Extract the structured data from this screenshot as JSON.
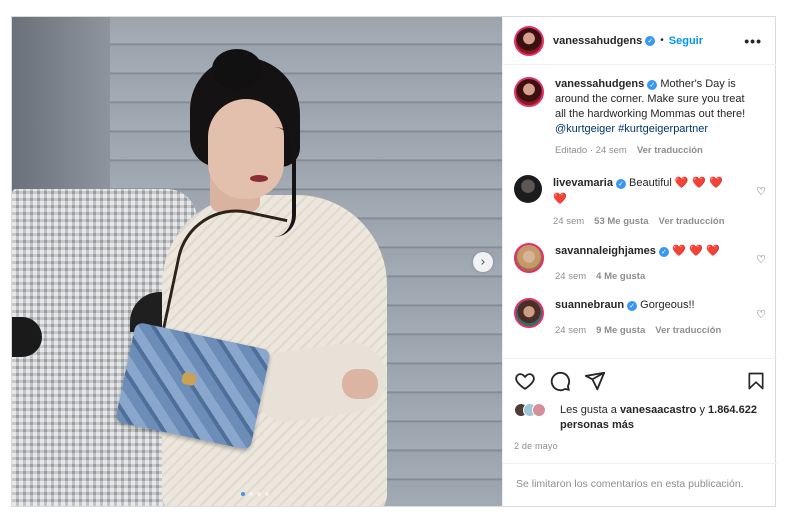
{
  "post": {
    "author": "vanessahudgens",
    "follow_label": "Seguir",
    "separator": "•",
    "more_label": "•••",
    "caption": {
      "username": "vanessahudgens",
      "text": "Mother's Day is around the corner. Make sure you treat all the hardworking Mommas out there!",
      "mention": "@kurtgeiger",
      "hashtag": "#kurtgeigerpartner",
      "edited_time": "Editado · 24 sem",
      "translate": "Ver traducción"
    },
    "comments": [
      {
        "username": "livevamaria",
        "text": "Beautiful",
        "hearts": "❤️ ❤️ ❤️",
        "extra_heart": "❤️",
        "time": "24 sem",
        "likes": "53 Me gusta",
        "translate": "Ver traducción"
      },
      {
        "username": "savannaleighjames",
        "text": "",
        "hearts": "❤️ ❤️ ❤️",
        "time": "24 sem",
        "likes": "4 Me gusta"
      },
      {
        "username": "suannebraun",
        "text": "Gorgeous!!",
        "time": "24 sem",
        "likes": "9 Me gusta",
        "translate": "Ver traducción"
      }
    ],
    "likes": {
      "prefix": "Les gusta a ",
      "user": "vanesaacastro",
      "middle": " y ",
      "count": "1.864.622",
      "suffix": "personas más"
    },
    "date": "2 de mayo",
    "comments_limited": "Se limitaron los comentarios en esta publicación.",
    "carousel": {
      "total": 4,
      "active": 1
    }
  },
  "icons": {
    "verified": "verified-badge-icon",
    "like": "heart-icon",
    "comment": "comment-icon",
    "share": "share-icon",
    "save": "bookmark-icon",
    "next": "chevron-right-icon"
  },
  "colors": {
    "accent": "#0095f6",
    "verified": "#3897f0",
    "heart_red": "#d10f1f"
  }
}
